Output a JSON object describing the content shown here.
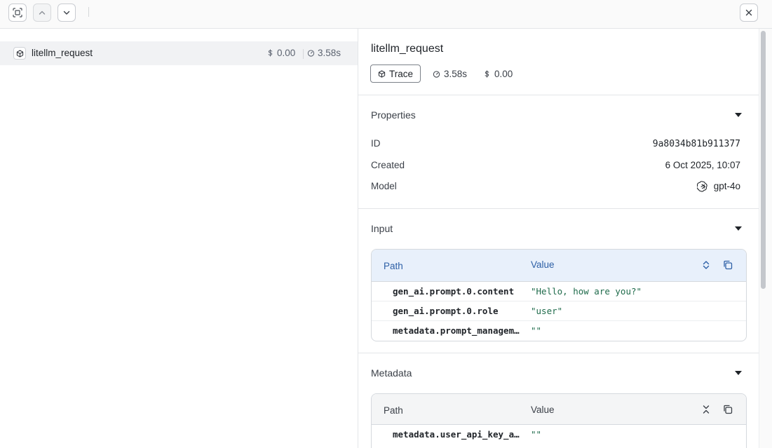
{
  "toolbar": {
    "buttons": [
      {
        "name": "focus-trace-button",
        "icon": "scan-icon"
      },
      {
        "name": "previous-button",
        "icon": "chevron-up-icon"
      },
      {
        "name": "next-button",
        "icon": "chevron-down-icon"
      },
      {
        "name": "close-button",
        "icon": "close-icon"
      }
    ]
  },
  "tree": {
    "items": [
      {
        "name": "litellm_request",
        "cost": "0.00",
        "duration": "3.58s",
        "icon": "cube-icon"
      }
    ]
  },
  "detail": {
    "title": "litellm_request",
    "type_badge": "Trace",
    "duration": "3.58s",
    "cost": "0.00",
    "sections": {
      "properties": {
        "title": "Properties",
        "rows": [
          {
            "label": "ID",
            "value": "9a8034b81b911377"
          },
          {
            "label": "Created",
            "value": "6 Oct 2025, 10:07"
          },
          {
            "label": "Model",
            "value": "gpt-4o",
            "icon": "openai-icon"
          }
        ]
      },
      "input": {
        "title": "Input",
        "header": {
          "path": "Path",
          "value": "Value"
        },
        "rows": [
          {
            "path": "gen_ai.prompt.0.content",
            "value": "\"Hello, how are you?\""
          },
          {
            "path": "gen_ai.prompt.0.role",
            "value": "\"user\""
          },
          {
            "path": "metadata.prompt_management_metadata",
            "value": "\"\""
          }
        ]
      },
      "metadata": {
        "title": "Metadata",
        "header": {
          "path": "Path",
          "value": "Value"
        },
        "rows": [
          {
            "path": "metadata.user_api_key_alias",
            "value": "\"\""
          }
        ]
      }
    }
  },
  "colors": {
    "accent": "#2d5fa6",
    "string_value": "#1f6b4b",
    "selected_row": "#f1f2f4"
  }
}
